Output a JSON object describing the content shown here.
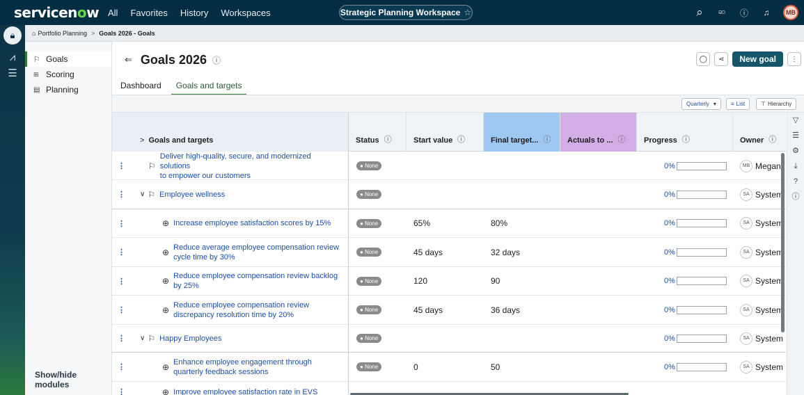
{
  "topnav": {
    "logo_a": "servicen",
    "logo_o": "o",
    "logo_b": "w",
    "links": [
      "All",
      "Favorites",
      "History",
      "Workspaces"
    ],
    "workspace": "Strategic Planning Workspace",
    "avatar": "MB"
  },
  "breadcrumb": {
    "parent": "Portfolio Planning",
    "separator": ">",
    "current": "Goals 2026 - Goals"
  },
  "sidebar": {
    "items": [
      {
        "icon": "flag-icon",
        "label": "Goals"
      },
      {
        "icon": "scoring-icon",
        "label": "Scoring"
      },
      {
        "icon": "planning-icon",
        "label": "Planning"
      }
    ],
    "footer": "Show/hide modules"
  },
  "header": {
    "title": "Goals 2026",
    "new_goal": "New goal",
    "tabs": [
      "Dashboard",
      "Goals and targets"
    ],
    "active_tab": "Goals and targets"
  },
  "toolbar": {
    "period": "Quarterly",
    "list": "List",
    "hierarchy": "Hierarchy"
  },
  "columns": {
    "goals": "Goals and targets",
    "status": "Status",
    "start": "Start value",
    "final": "Final target...",
    "actuals": "Actuals to ...",
    "progress": "Progress",
    "owner": "Owner"
  },
  "colors": {
    "final_header": "#9ec8f2",
    "actuals_header": "#d3aee6",
    "nav_bg": "#032d42",
    "link": "#1e4fa8"
  },
  "rows": [
    {
      "type": "goal",
      "indent": 0,
      "name1": "Deliver high-quality, secure, and modernized solutions",
      "name2": "to empower our customers",
      "status": "None",
      "start": "",
      "final": "",
      "progress": "0%",
      "owner_initials": "MB",
      "owner": "Megan"
    },
    {
      "type": "group",
      "indent": 0,
      "name1": "Employee wellness",
      "name2": "",
      "status": "None",
      "start": "",
      "final": "",
      "progress": "0%",
      "owner_initials": "SA",
      "owner": "System"
    },
    {
      "type": "target",
      "indent": 1,
      "name1": "Increase employee satisfaction scores by 15%",
      "name2": "",
      "status": "None",
      "start": "65%",
      "final": "80%",
      "progress": "0%",
      "owner_initials": "SA",
      "owner": "System"
    },
    {
      "type": "target",
      "indent": 1,
      "name1": "Reduce average employee compensation review",
      "name2": "cycle time by 30%",
      "status": "None",
      "start": "45 days",
      "final": "32 days",
      "progress": "0%",
      "owner_initials": "SA",
      "owner": "System"
    },
    {
      "type": "target",
      "indent": 1,
      "name1": "Reduce employee compensation review backlog",
      "name2": "by 25%",
      "status": "None",
      "start": "120",
      "final": "90",
      "progress": "0%",
      "owner_initials": "SA",
      "owner": "System"
    },
    {
      "type": "target",
      "indent": 1,
      "name1": "Reduce employee compensation review",
      "name2": "discrepancy resolution time by 20%",
      "status": "None",
      "start": "45 days",
      "final": "36 days",
      "progress": "0%",
      "owner_initials": "SA",
      "owner": "System"
    },
    {
      "type": "group",
      "indent": 0,
      "name1": "Happy Employees",
      "name2": "",
      "status": "None",
      "start": "",
      "final": "",
      "progress": "0%",
      "owner_initials": "SA",
      "owner": "System"
    },
    {
      "type": "target",
      "indent": 1,
      "name1": "Enhance employee engagement through",
      "name2": "quarterly feedback sessions",
      "status": "None",
      "start": "0",
      "final": "50",
      "progress": "0%",
      "owner_initials": "SA",
      "owner": "System"
    },
    {
      "type": "target",
      "indent": 1,
      "name1": "Improve employee satisfaction rate in EVS",
      "name2": "",
      "status": "",
      "start": "",
      "final": "",
      "progress": "",
      "owner_initials": "",
      "owner": ""
    }
  ]
}
